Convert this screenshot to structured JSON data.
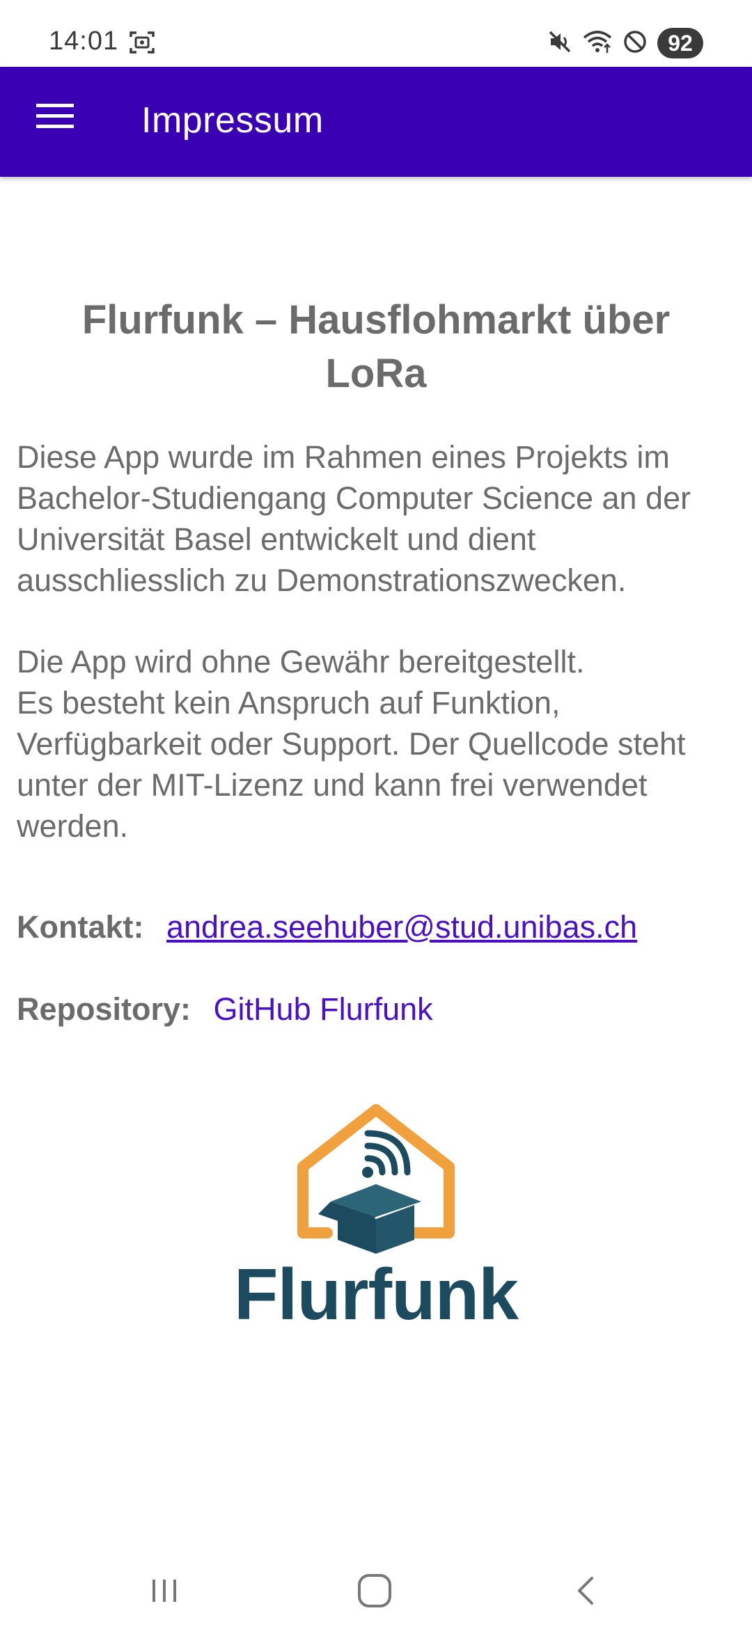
{
  "status_bar": {
    "time": "14:01",
    "battery": "92",
    "icons": [
      "screenshot-icon",
      "mute-icon",
      "wifi-icon",
      "do-not-disturb-icon"
    ]
  },
  "app_bar": {
    "title": "Impressum",
    "menu_icon": "hamburger-menu-icon",
    "background": "#3a00b4"
  },
  "content": {
    "heading": "Flurfunk – Hausflohmarkt über LoRa",
    "paragraph1": "Diese App wurde im Rahmen eines Projekts im Bachelor-Studiengang Computer Science an der Universität Basel entwickelt und dient ausschliesslich zu Demonstrationszwecken.",
    "paragraph2_line1": "Die App wird ohne Gewähr bereitgestellt.",
    "paragraph2_line2": "Es besteht kein Anspruch auf Funktion, Verfügbarkeit oder Support. Der Quellcode steht unter der MIT-Lizenz und kann frei verwendet werden.",
    "contact_label": "Kontakt:",
    "contact_email": "andrea.seehuber@stud.unibas.ch",
    "repository_label": "Repository:",
    "repository_link": "GitHub Flurfunk",
    "link_color": "#4a10c8"
  },
  "logo": {
    "text": "Flurfunk",
    "house_color": "#f0a03c",
    "box_color": "#1c4a5e"
  },
  "nav_bar": {
    "buttons": [
      "recent-apps-icon",
      "home-icon",
      "back-icon"
    ]
  }
}
